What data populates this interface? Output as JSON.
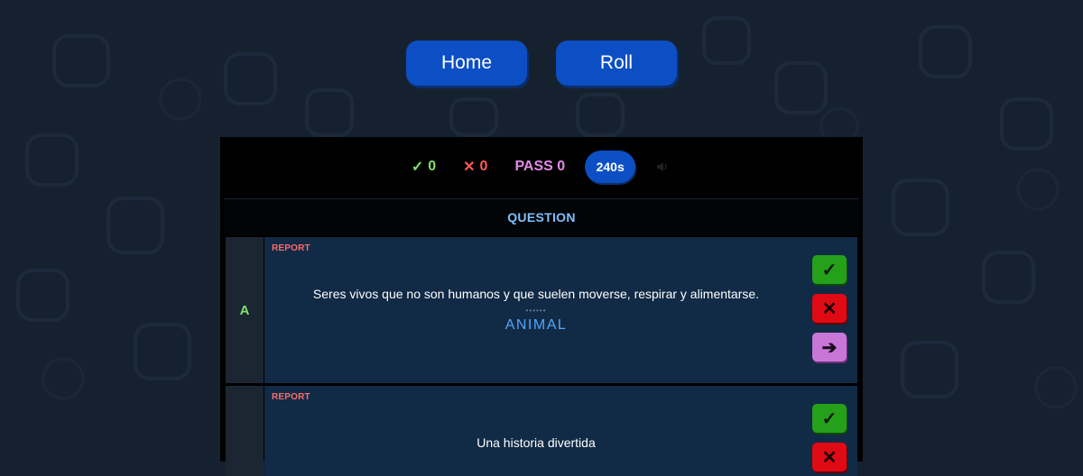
{
  "nav": {
    "home_label": "Home",
    "roll_label": "Roll"
  },
  "stats": {
    "correct_icon": "✓",
    "correct_count": "0",
    "wrong_icon": "✕",
    "wrong_count": "0",
    "pass_label": "PASS 0",
    "timer": "240s",
    "speaker_icon": "speaker-icon"
  },
  "table": {
    "header": "QUESTION"
  },
  "rows": [
    {
      "letter": "A",
      "report_label": "REPORT",
      "clue": "Seres vivos que no son humanos y que suelen moverse, respirar y alimentarse.",
      "dots": "••••••",
      "answer": "ANIMAL",
      "buttons": {
        "correct": "✓",
        "wrong": "✕",
        "skip": "➔"
      }
    },
    {
      "letter": "",
      "report_label": "REPORT",
      "clue": "Una historia divertida",
      "buttons": {
        "correct": "✓",
        "wrong": "✕"
      }
    }
  ],
  "colors": {
    "background": "#162130",
    "accent": "#0c4fc4",
    "correct": "#24a01a",
    "wrong": "#e00a14",
    "skip": "#c877d8",
    "answer": "#52a7ff",
    "report": "#ff6b6b"
  }
}
